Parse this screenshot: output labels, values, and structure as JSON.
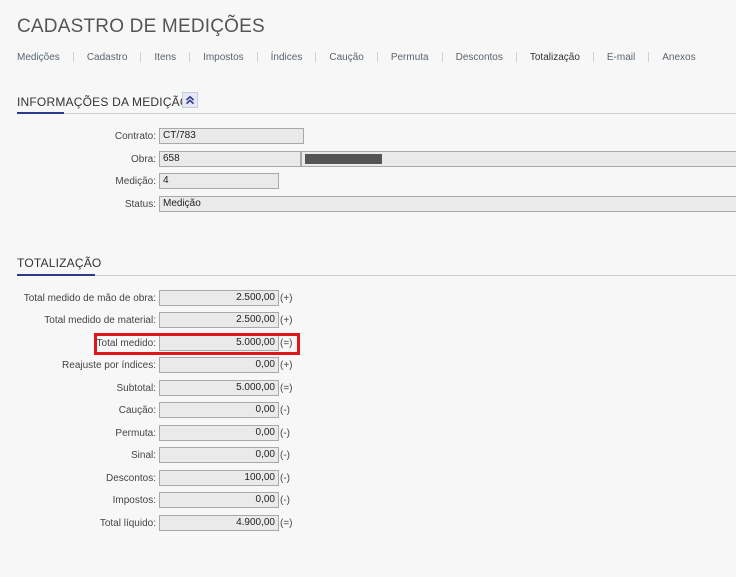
{
  "page": {
    "title": "CADASTRO DE MEDIÇÕES"
  },
  "tabs": [
    {
      "label": "Medições"
    },
    {
      "label": "Cadastro"
    },
    {
      "label": "Itens"
    },
    {
      "label": "Impostos"
    },
    {
      "label": "Índices"
    },
    {
      "label": "Caução"
    },
    {
      "label": "Permuta"
    },
    {
      "label": "Descontos"
    },
    {
      "label": "Totalização",
      "active": true
    },
    {
      "label": "E-mail"
    },
    {
      "label": "Anexos"
    }
  ],
  "info": {
    "title": "INFORMAÇÕES DA MEDIÇÃO",
    "collapse_icon": "double-chevron-up-icon",
    "contrato": {
      "label": "Contrato:",
      "value": "CT/783"
    },
    "obra": {
      "label": "Obra:",
      "value": "658"
    },
    "medicao": {
      "label": "Medição:",
      "value": "4"
    },
    "status": {
      "label": "Status:",
      "value": "Medição"
    }
  },
  "totalizacao": {
    "title": "TOTALIZAÇÃO",
    "rows": [
      {
        "label": "Total medido de mão de obra:",
        "value": "2.500,00",
        "op": "(+)"
      },
      {
        "label": "Total medido de material:",
        "value": "2.500,00",
        "op": "(+)"
      },
      {
        "label": "Total medido:",
        "value": "5.000,00",
        "op": "(=)",
        "highlighted": true
      },
      {
        "label": "Reajuste por índices:",
        "value": "0,00",
        "op": "(+)"
      },
      {
        "label": "Subtotal:",
        "value": "5.000,00",
        "op": "(=)"
      },
      {
        "label": "Caução:",
        "value": "0,00",
        "op": "(-)"
      },
      {
        "label": "Permuta:",
        "value": "0,00",
        "op": "(-)"
      },
      {
        "label": "Sinal:",
        "value": "0,00",
        "op": "(-)"
      },
      {
        "label": "Descontos:",
        "value": "100,00",
        "op": "(-)"
      },
      {
        "label": "Impostos:",
        "value": "0,00",
        "op": "(-)"
      },
      {
        "label": "Total líquido:",
        "value": "4.900,00",
        "op": "(=)"
      }
    ]
  },
  "colors": {
    "accent": "#2b3a8c",
    "highlight": "#e0161b"
  }
}
